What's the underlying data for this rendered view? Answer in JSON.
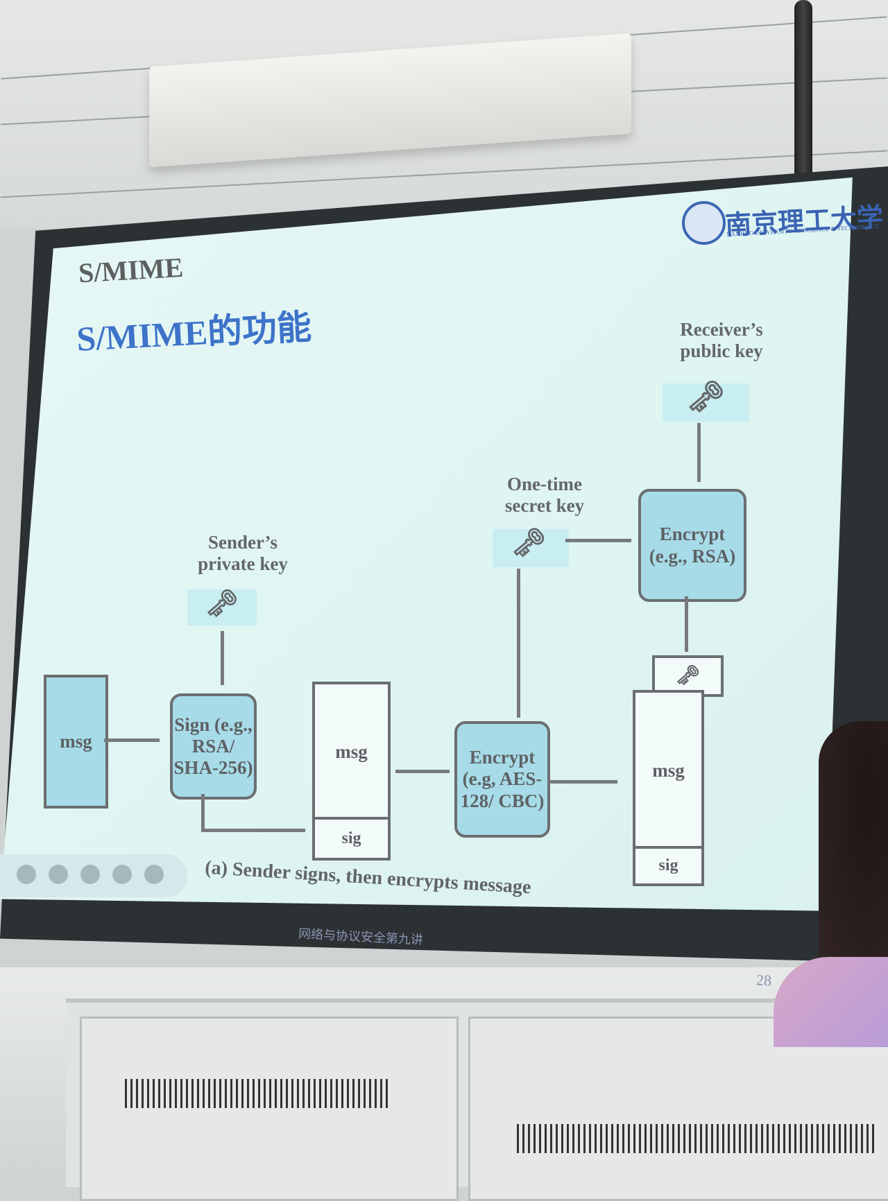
{
  "slide": {
    "section": "S/MIME",
    "title": "S/MIME的功能",
    "logo_text": "南京理工大学",
    "logo_subtext": "NANJING UNIVERSITY OF SCIENCE & TECHNOLOGY",
    "footer": "网络与协议安全第九讲",
    "page": "28"
  },
  "diagram": {
    "msg_label": "msg",
    "sig_label": "sig",
    "sign_box": "Sign (e.g., RSA/ SHA-256)",
    "encrypt_aes": "Encrypt (e.g, AES-128/ CBC)",
    "encrypt_rsa": "Encrypt (e.g., RSA)",
    "sender_key": "Sender’s private key",
    "secret_key": "One-time secret key",
    "receiver_key": "Receiver’s public key",
    "caption": "(a) Sender signs, then encrypts message"
  }
}
